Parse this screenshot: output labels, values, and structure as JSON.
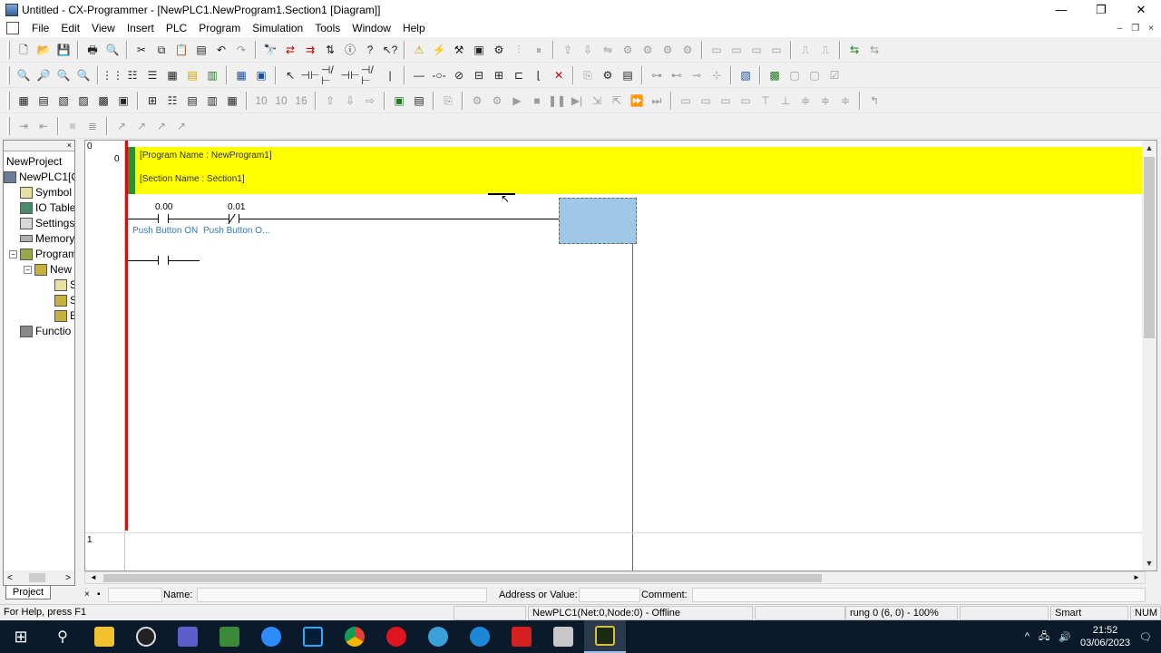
{
  "window": {
    "title": "Untitled - CX-Programmer - [NewPLC1.NewProgram1.Section1 [Diagram]]",
    "controls": {
      "minimize": "—",
      "restore": "❐",
      "close": "✕"
    }
  },
  "menu": {
    "items": [
      "File",
      "Edit",
      "View",
      "Insert",
      "PLC",
      "Program",
      "Simulation",
      "Tools",
      "Window",
      "Help"
    ],
    "mdi_controls": {
      "minimize": "–",
      "restore": "❐",
      "close": "×"
    }
  },
  "project_tree": {
    "header": "×",
    "items": [
      {
        "label": "NewProject",
        "icon": "none"
      },
      {
        "label": "NewPLC1[C",
        "icon": "plc-icon"
      },
      {
        "label": "Symbol",
        "icon": "symbol-table-icon"
      },
      {
        "label": "IO Table",
        "icon": "io-table-icon"
      },
      {
        "label": "Settings",
        "icon": "settings-icon"
      },
      {
        "label": "Memory",
        "icon": "memory-icon"
      },
      {
        "label": "Program",
        "icon": "programs-icon"
      },
      {
        "label": "New",
        "icon": "new-program-icon"
      },
      {
        "label": "S",
        "icon": "section-icon"
      },
      {
        "label": "S",
        "icon": "section-icon"
      },
      {
        "label": "E",
        "icon": "end-section-icon"
      },
      {
        "label": "Functio",
        "icon": "function-block-icon"
      }
    ],
    "expanders": {
      "plc": "−",
      "program": "−",
      "new": "−"
    },
    "scroll_left": "<",
    "scroll_right": ">",
    "tab": "Project"
  },
  "diagram": {
    "header_row": "0",
    "program_name": "[Program Name : NewProgram1]",
    "section_name": "[Section Name : Section1]",
    "rungs": [
      {
        "number": "0",
        "contacts": [
          {
            "address": "0.00",
            "comment": "Push Button ON",
            "type": "normally-open"
          },
          {
            "address": "0.01",
            "comment": "Push Button O...",
            "type": "normally-closed"
          }
        ]
      },
      {
        "number": "1"
      }
    ],
    "scroll_up": "▲",
    "scroll_down": "▼",
    "scroll_left": "◄",
    "scroll_right": "►"
  },
  "name_bar": {
    "close": "×",
    "pin": "▪",
    "name_label": "Name:",
    "address_label": "Address or Value:",
    "comment_label": "Comment:"
  },
  "status": {
    "help": "For Help, press F1",
    "plc": "NewPLC1(Net:0,Node:0) - Offline",
    "position": "rung 0 (6, 0)  - 100%",
    "mode": "Smart",
    "num": "NUM"
  },
  "taskbar": {
    "time": "21:52",
    "date": "03/06/2023",
    "tray_caret": "^"
  },
  "colors": {
    "section_header": "#ffff00",
    "left_rail": "#d01010",
    "right_rail": "#3a8a3a",
    "comment": "#2f7ab8",
    "cursor": "#9fc7e6"
  }
}
